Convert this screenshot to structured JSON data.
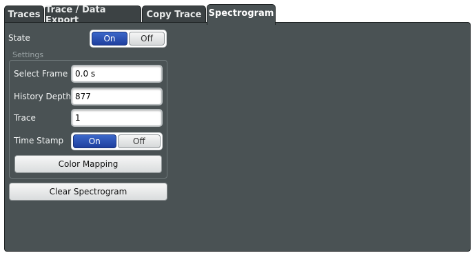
{
  "tabs": [
    {
      "label": "Traces"
    },
    {
      "label": "Trace / Data Export"
    },
    {
      "label": "Copy Trace"
    },
    {
      "label": "Spectrogram"
    }
  ],
  "state": {
    "label": "State",
    "on": "On",
    "off": "Off",
    "selected": "On"
  },
  "settings": {
    "caption": "Settings",
    "select_frame": {
      "label": "Select Frame",
      "value": "0.0 s"
    },
    "history_depth": {
      "label": "History Depth",
      "value": "877"
    },
    "trace": {
      "label": "Trace",
      "value": "1"
    },
    "time_stamp": {
      "label": "Time Stamp",
      "on": "On",
      "off": "Off",
      "selected": "On"
    },
    "color_mapping": "Color Mapping"
  },
  "clear_spectrogram": "Clear Spectrogram"
}
